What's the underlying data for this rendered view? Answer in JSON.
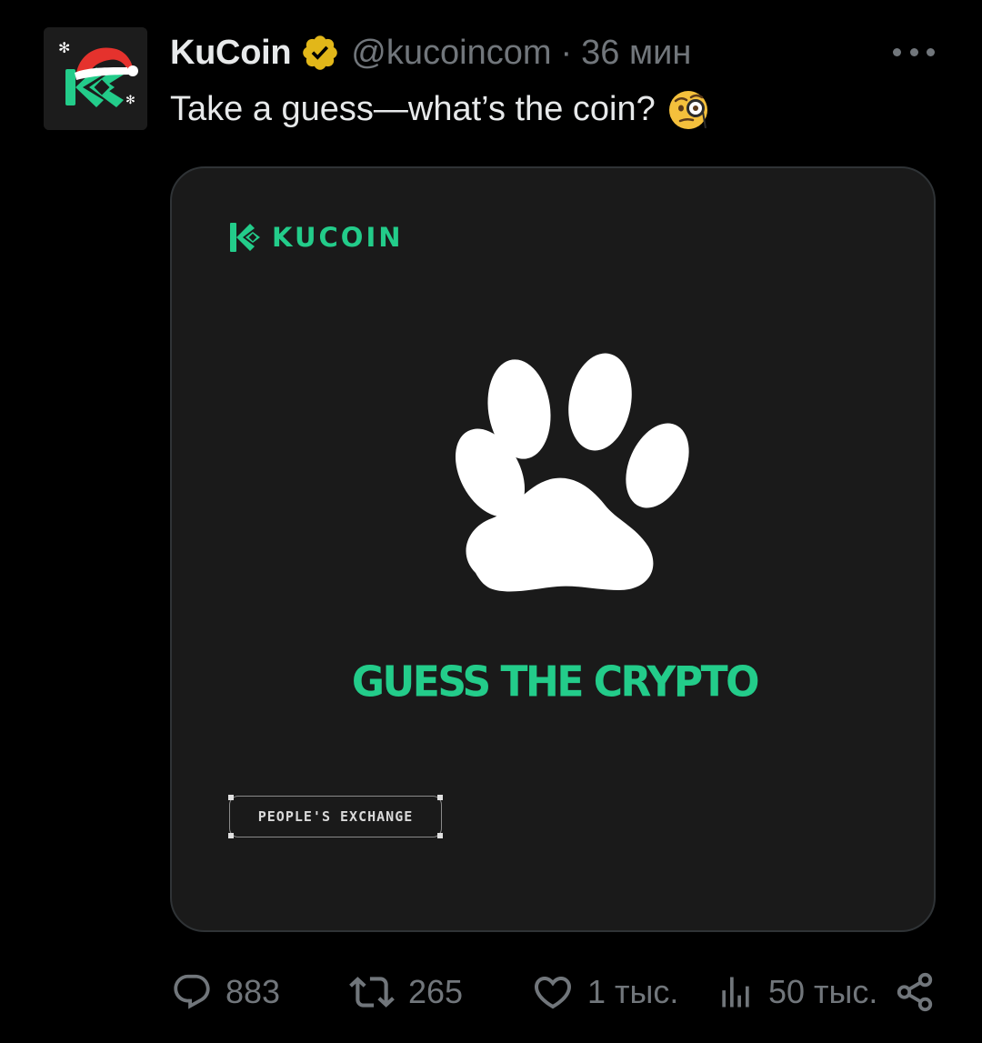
{
  "tweet": {
    "author": {
      "display_name": "KuCoin",
      "handle": "@kucoincom",
      "verified": true,
      "avatar_icon": "kucoin-santa-hat-logo-icon"
    },
    "separator": "·",
    "timestamp": "36 мин",
    "text": "Take a guess—what’s the coin?",
    "emoji": "face-with-monocle"
  },
  "media": {
    "brand_name": "KUCOIN",
    "graphic_icon": "paw-print-icon",
    "headline": "GUESS THE CRYPTO",
    "tagline": "PEOPLE'S EXCHANGE"
  },
  "actions": {
    "replies": "883",
    "retweets": "265",
    "likes": "1 тыс.",
    "views": "50 тыс."
  },
  "colors": {
    "background": "#000000",
    "card_background": "#1a1a1a",
    "brand_green": "#23cc8a",
    "text_primary": "#e7e9ea",
    "text_secondary": "#71767b",
    "verified_gold": "#e2b719"
  }
}
